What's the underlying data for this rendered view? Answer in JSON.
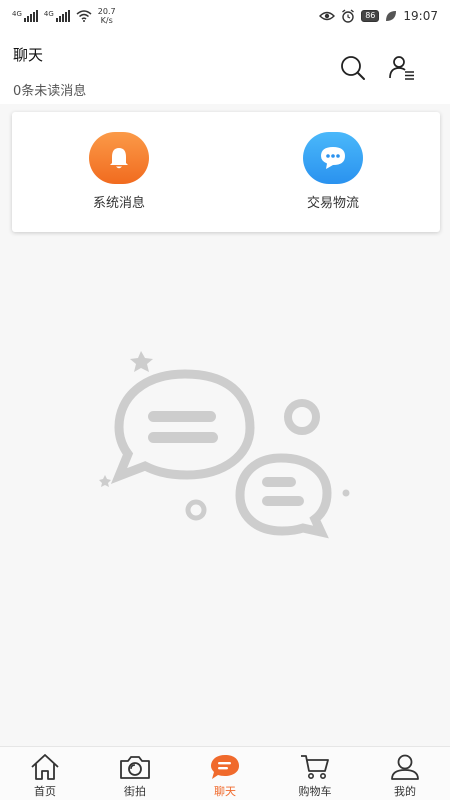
{
  "status_bar": {
    "sim1": "4G",
    "sim2": "4G",
    "net_speed": "20.7",
    "net_unit": "K/s",
    "battery": "86",
    "time": "19:07"
  },
  "header": {
    "title": "聊天",
    "unread": "0条未读消息",
    "search_icon": "search-icon",
    "contacts_icon": "contacts-icon"
  },
  "quick_actions": [
    {
      "label": "系统消息",
      "icon": "bell-icon",
      "color": "#f47a28"
    },
    {
      "label": "交易物流",
      "icon": "chat-bubble-icon",
      "color": "#2a9ff5"
    }
  ],
  "empty_illustration": "empty-chat-illustration",
  "tabbar": {
    "tabs": [
      {
        "label": "首页",
        "icon": "home-icon"
      },
      {
        "label": "街拍",
        "icon": "camera-icon"
      },
      {
        "label": "聊天",
        "icon": "chat-icon",
        "active": true
      },
      {
        "label": "购物车",
        "icon": "cart-icon"
      },
      {
        "label": "我的",
        "icon": "profile-icon"
      }
    ],
    "active_color": "#f06a2c"
  }
}
